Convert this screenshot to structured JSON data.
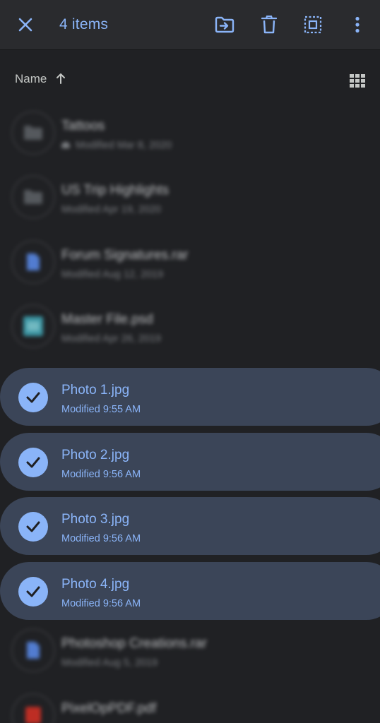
{
  "toolbar": {
    "selected_count": "4 items",
    "accent_color": "#8ab4f8",
    "close_icon": "close-icon",
    "move_icon": "move-to-folder-icon",
    "delete_icon": "trash-icon",
    "select_all_icon": "select-all-icon",
    "more_icon": "more-vert-icon"
  },
  "sort": {
    "label": "Name",
    "direction": "ascending",
    "view_toggle_icon": "grid-view-icon"
  },
  "files": [
    {
      "name": "Tattoos",
      "meta": "Modified Mar 8, 2020",
      "type": "folder",
      "shared": true,
      "selected": false
    },
    {
      "name": "US Trip Highlights",
      "meta": "Modified Apr 19, 2020",
      "type": "folder",
      "shared": false,
      "selected": false
    },
    {
      "name": "Forum Signatures.rar",
      "meta": "Modified Aug 12, 2019",
      "type": "document",
      "shared": false,
      "selected": false
    },
    {
      "name": "Master File.psd",
      "meta": "Modified Apr 26, 2019",
      "type": "image",
      "shared": false,
      "selected": false
    },
    {
      "name": "Photo 1.jpg",
      "meta": "Modified 9:55 AM",
      "type": "image",
      "shared": false,
      "selected": true
    },
    {
      "name": "Photo 2.jpg",
      "meta": "Modified 9:56 AM",
      "type": "image",
      "shared": false,
      "selected": true
    },
    {
      "name": "Photo 3.jpg",
      "meta": "Modified 9:56 AM",
      "type": "image",
      "shared": false,
      "selected": true
    },
    {
      "name": "Photo 4.jpg",
      "meta": "Modified 9:56 AM",
      "type": "image",
      "shared": false,
      "selected": true
    },
    {
      "name": "Photoshop Creations.rar",
      "meta": "Modified Aug 5, 2019",
      "type": "document",
      "shared": false,
      "selected": false
    },
    {
      "name": "PixelOpPDF.pdf",
      "meta": "",
      "type": "pdf",
      "shared": false,
      "selected": false
    }
  ]
}
